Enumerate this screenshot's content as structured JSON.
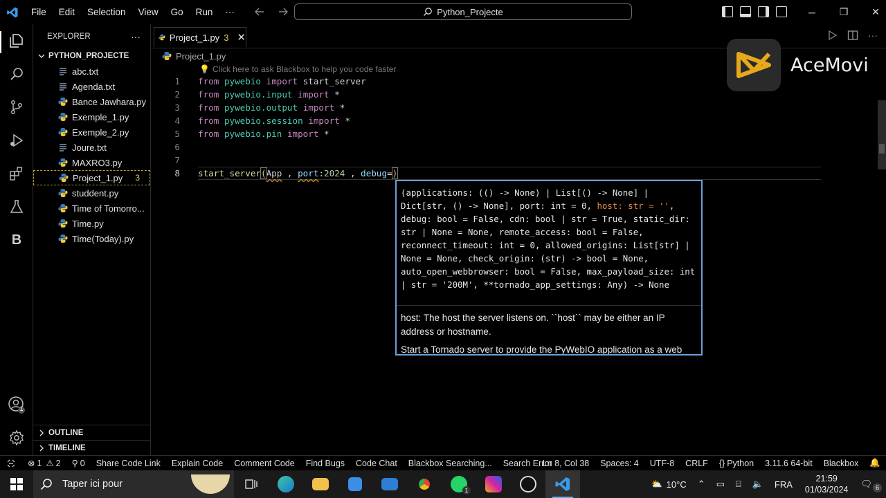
{
  "menu": [
    "File",
    "Edit",
    "Selection",
    "View",
    "Go",
    "Run",
    "···"
  ],
  "command_center": "Python_Projecte",
  "window_controls": [
    "─",
    "❐",
    "✕"
  ],
  "explorer": {
    "title": "EXPLORER",
    "more": "···",
    "project": "PYTHON_PROJECTE",
    "files": [
      {
        "name": "abc.txt",
        "type": "txt"
      },
      {
        "name": "Agenda.txt",
        "type": "txt"
      },
      {
        "name": "Bance Jawhara.py",
        "type": "py"
      },
      {
        "name": "Exemple_1.py",
        "type": "py"
      },
      {
        "name": "Exemple_2.py",
        "type": "py"
      },
      {
        "name": "Joure.txt",
        "type": "txt"
      },
      {
        "name": "MAXRO3.py",
        "type": "py"
      },
      {
        "name": "Project_1.py",
        "type": "py",
        "badge": "3",
        "active": true
      },
      {
        "name": "studdent.py",
        "type": "py"
      },
      {
        "name": "Time of Tomorro...",
        "type": "py"
      },
      {
        "name": "Time.py",
        "type": "py"
      },
      {
        "name": "Time(Today).py",
        "type": "py"
      }
    ],
    "outline": "OUTLINE",
    "timeline": "TIMELINE"
  },
  "activity_letter": "B",
  "account_badge": "1",
  "tab": {
    "label": "Project_1.py",
    "problems": "3",
    "close": "✕"
  },
  "breadcrumb": "Project_1.py",
  "hint": "Click here to ask Blackbox to help you code faster",
  "code": {
    "line_numbers": [
      "1",
      "2",
      "3",
      "4",
      "5",
      "6",
      "7",
      "8"
    ],
    "from_kw": "from",
    "import_kw": "import",
    "lines": [
      {
        "module": "pywebio",
        "target": "start_server"
      },
      {
        "module": "pywebio.input",
        "target": "*"
      },
      {
        "module": "pywebio.output",
        "target": "*"
      },
      {
        "module": "pywebio.session",
        "target": "*"
      },
      {
        "module": "pywebio.pin",
        "target": "*"
      }
    ],
    "line8": {
      "fn": "start_server",
      "open": "(",
      "app": "App",
      "sep1": " , ",
      "port_kw": "port",
      "colon": ":",
      "port_val": "2024",
      "sep2": " , ",
      "debug_kw": "debug",
      "eq": "=",
      "close": ")"
    }
  },
  "signature": {
    "before": "(applications: (() -> None) | List[() -> None] | Dict[str, () -> None], port: int = 0, ",
    "highlight": "host: str = ''",
    "after": ", debug: bool = False, cdn: bool | str = True, static_dir: str | None = None, remote_access: bool = False, reconnect_timeout: int = 0, allowed_origins: List[str] | None = None, check_origin: (str) -> bool = None, auto_open_webbrowser: bool = False, max_payload_size: int | str = '200M', **tornado_app_settings: Any) -> None",
    "doc1": "host: The host the server listens on. ``host`` may be either an IP address or hostname.",
    "doc2": "Start a Tornado server to provide the PyWebIO application as a web"
  },
  "watermark": "AceMovi",
  "status": {
    "errors": "1",
    "warnings": "2",
    "ports": "0",
    "items": [
      "Share Code Link",
      "Explain Code",
      "Comment Code",
      "Find Bugs",
      "Code Chat",
      "Blackbox Searching...",
      "Search Error"
    ],
    "position": "Ln 8, Col 38",
    "spaces": "Spaces: 4",
    "encoding": "UTF-8",
    "eol": "CRLF",
    "language": "Python",
    "interpreter": "3.11.6 64-bit",
    "ext": "Blackbox"
  },
  "taskbar": {
    "search_placeholder": "Taper ici pour",
    "temperature": "10°C",
    "lang": "FRA",
    "time": "21:59",
    "date": "01/03/2024",
    "notif": "6",
    "whatsapp_badge": "1"
  },
  "colors": {
    "accent": "#6aa0d6",
    "keyword": "#c586c0",
    "module": "#4ec9b0",
    "function": "#dcdcaa",
    "number": "#b5cea8",
    "warning": "#e0c46c"
  }
}
